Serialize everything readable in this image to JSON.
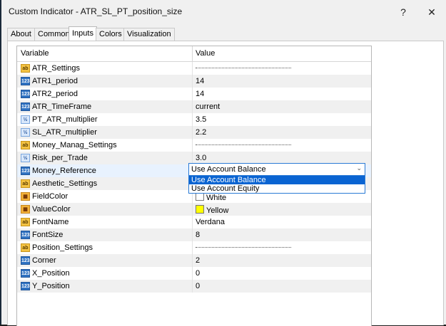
{
  "window": {
    "title": "Custom Indicator - ATR_SL_PT_position_size",
    "help_label": "?",
    "close_label": "✕"
  },
  "tabs": [
    "About",
    "Common",
    "Inputs",
    "Colors",
    "Visualization"
  ],
  "active_tab": "Inputs",
  "table": {
    "col_variable": "Variable",
    "col_value": "Value",
    "rows": [
      {
        "icon": "ab",
        "variable": "ATR_Settings",
        "value": "",
        "type": "separator"
      },
      {
        "icon": "123",
        "variable": "ATR1_period",
        "value": "14"
      },
      {
        "icon": "123",
        "variable": "ATR2_period",
        "value": "14"
      },
      {
        "icon": "123",
        "variable": "ATR_TimeFrame",
        "value": "current"
      },
      {
        "icon": "½",
        "variable": "PT_ATR_multiplier",
        "value": "3.5"
      },
      {
        "icon": "½",
        "variable": "SL_ATR_multiplier",
        "value": "2.2"
      },
      {
        "icon": "ab",
        "variable": "Money_Manag_Settings",
        "value": "",
        "type": "separator"
      },
      {
        "icon": "½",
        "variable": "Risk_per_Trade",
        "value": "3.0"
      },
      {
        "icon": "123",
        "variable": "Money_Reference",
        "value": "Use Account Balance",
        "type": "combo"
      },
      {
        "icon": "ab",
        "variable": "Aesthetic_Settings",
        "value": "",
        "type": "separator"
      },
      {
        "icon": "clr",
        "variable": "FieldColor",
        "value": "White",
        "color": "#ffffff"
      },
      {
        "icon": "clr",
        "variable": "ValueColor",
        "value": "Yellow",
        "color": "#ffff00"
      },
      {
        "icon": "ab",
        "variable": "FontName",
        "value": "Verdana"
      },
      {
        "icon": "123",
        "variable": "FontSize",
        "value": "8"
      },
      {
        "icon": "ab",
        "variable": "Position_Settings",
        "value": "",
        "type": "separator"
      },
      {
        "icon": "123",
        "variable": "Corner",
        "value": "2"
      },
      {
        "icon": "123",
        "variable": "X_Position",
        "value": "0"
      },
      {
        "icon": "123",
        "variable": "Y_Position",
        "value": "0"
      }
    ]
  },
  "combo": {
    "selected": "Use Account Balance",
    "options": [
      "Use Account Balance",
      "Use Account Equity"
    ]
  },
  "colors": {
    "accent": "#0a64d2",
    "row_alt": "#f0f0f0",
    "row_selected": "#e8f2fe"
  }
}
